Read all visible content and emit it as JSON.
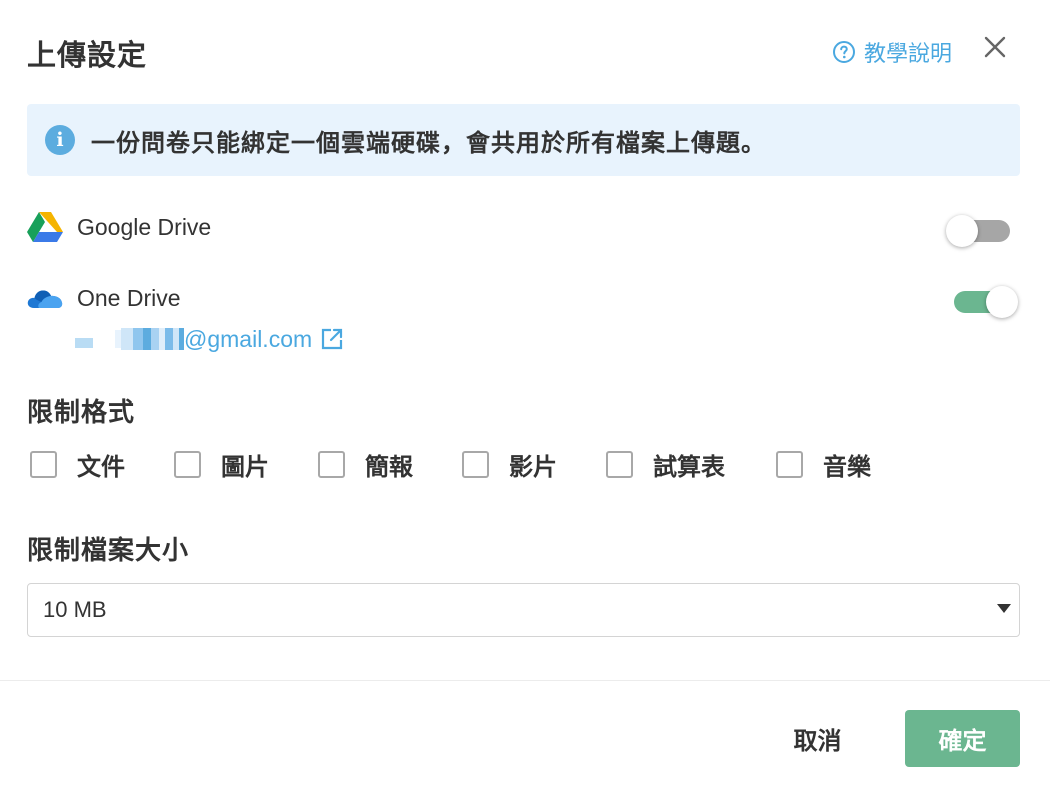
{
  "dialog": {
    "title": "上傳設定",
    "help_label": "教學說明"
  },
  "info": {
    "message": "一份問卷只能綁定一個雲端硬碟，會共用於所有檔案上傳題。"
  },
  "drives": {
    "google": {
      "label": "Google Drive",
      "enabled": false
    },
    "onedrive": {
      "label": "One Drive",
      "enabled": true,
      "account_email": "@gmail.com"
    }
  },
  "format_section": {
    "title": "限制格式",
    "options": [
      {
        "label": "文件",
        "checked": false
      },
      {
        "label": "圖片",
        "checked": false
      },
      {
        "label": "簡報",
        "checked": false
      },
      {
        "label": "影片",
        "checked": false
      },
      {
        "label": "試算表",
        "checked": false
      },
      {
        "label": "音樂",
        "checked": false
      }
    ]
  },
  "size_section": {
    "title": "限制檔案大小",
    "selected": "10 MB"
  },
  "footer": {
    "cancel_label": "取消",
    "confirm_label": "確定"
  },
  "colors": {
    "accent_green": "#6bb690",
    "link_blue": "#4aa8e0",
    "info_bg": "#e8f3fd"
  }
}
